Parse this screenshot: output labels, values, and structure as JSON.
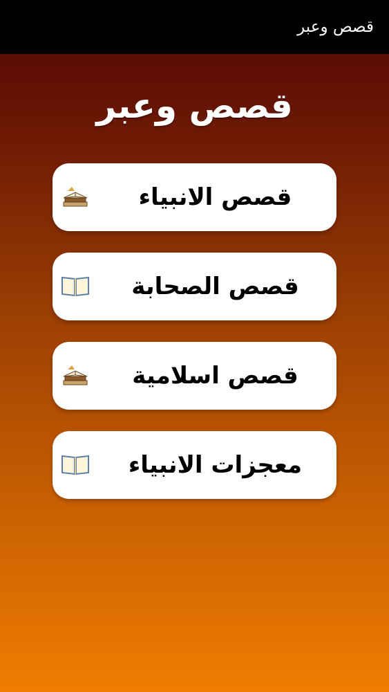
{
  "app_bar": {
    "title": "قصص وعبر"
  },
  "page": {
    "title": "قصص وعبر"
  },
  "menu": {
    "items": [
      {
        "label": "قصص الانبياء",
        "icon": "books-stack-icon"
      },
      {
        "label": "قصص الصحابة",
        "icon": "open-book-icon"
      },
      {
        "label": "قصص اسلامية",
        "icon": "books-stack-icon"
      },
      {
        "label": "معجزات الانبياء",
        "icon": "open-book-icon"
      }
    ]
  },
  "colors": {
    "app_bar": "#000000",
    "gradient_top": "#4e0203",
    "gradient_bottom": "#ef7d01",
    "button_bg": "#ffffff",
    "button_text": "#000000",
    "title_text": "#ffffff"
  }
}
